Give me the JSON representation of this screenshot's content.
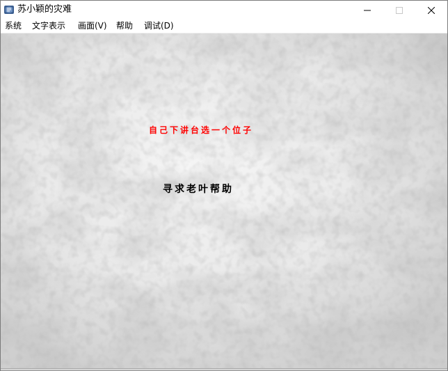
{
  "window": {
    "title": "苏小颖的灾难",
    "icon": "game-app-icon"
  },
  "controls": {
    "minimize_icon": "minimize-icon",
    "maximize_icon": "maximize-icon",
    "close_icon": "close-icon"
  },
  "menu": {
    "items": [
      {
        "label": "系统"
      },
      {
        "label": "文字表示"
      },
      {
        "label": "画面(V)"
      },
      {
        "label": "帮助"
      },
      {
        "label": "调试(D)"
      }
    ]
  },
  "scene": {
    "choices": [
      {
        "label": "自己下讲台选一个位子",
        "color": "#ff0000",
        "selected": true
      },
      {
        "label": "寻求老叶帮助",
        "color": "#000000",
        "selected": false
      }
    ]
  }
}
